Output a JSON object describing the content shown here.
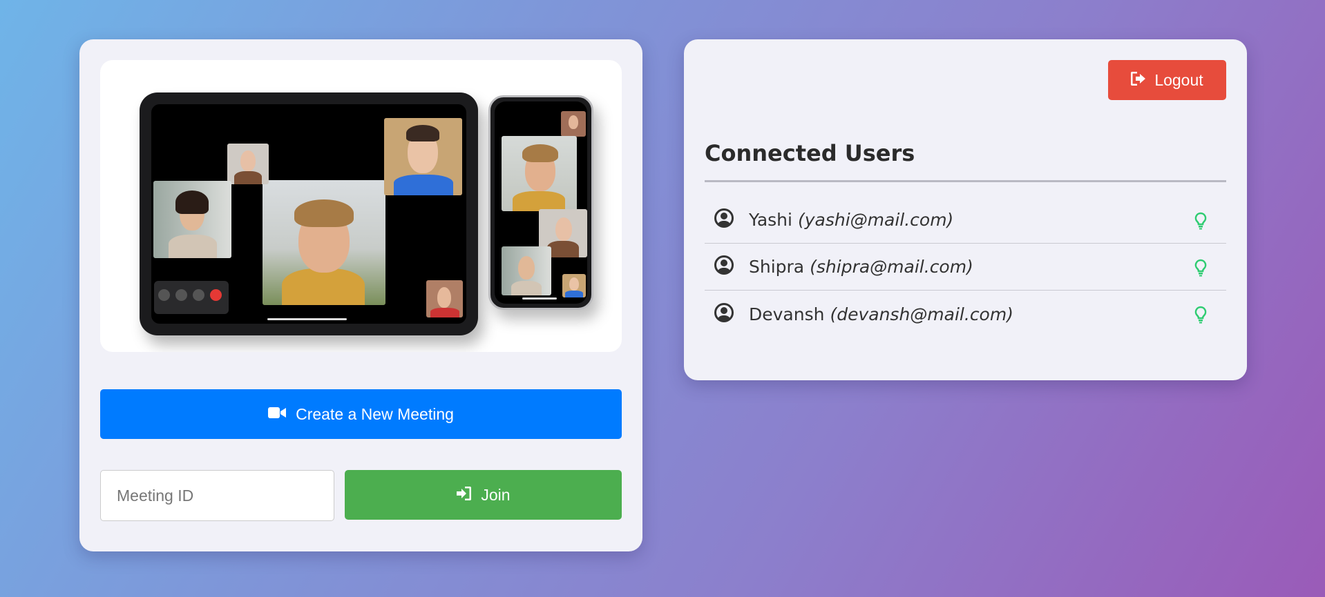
{
  "meeting": {
    "create_label": "Create a New Meeting",
    "id_placeholder": "Meeting ID",
    "join_label": "Join"
  },
  "account": {
    "logout_label": "Logout"
  },
  "connected_users": {
    "title": "Connected Users",
    "users": [
      {
        "name": "Yashi",
        "email": "(yashi@mail.com)",
        "status": "online"
      },
      {
        "name": "Shipra",
        "email": "(shipra@mail.com)",
        "status": "online"
      },
      {
        "name": "Devansh",
        "email": "(devansh@mail.com)",
        "status": "online"
      }
    ]
  },
  "icons": {
    "create": "video-camera-icon",
    "join": "sign-in-icon",
    "logout": "sign-out-icon",
    "user": "user-circle-icon",
    "status": "lightbulb-icon"
  },
  "colors": {
    "create_button": "#007bff",
    "join_button": "#4cae4f",
    "logout_button": "#e74c3c",
    "status_online": "#2ecc71"
  }
}
